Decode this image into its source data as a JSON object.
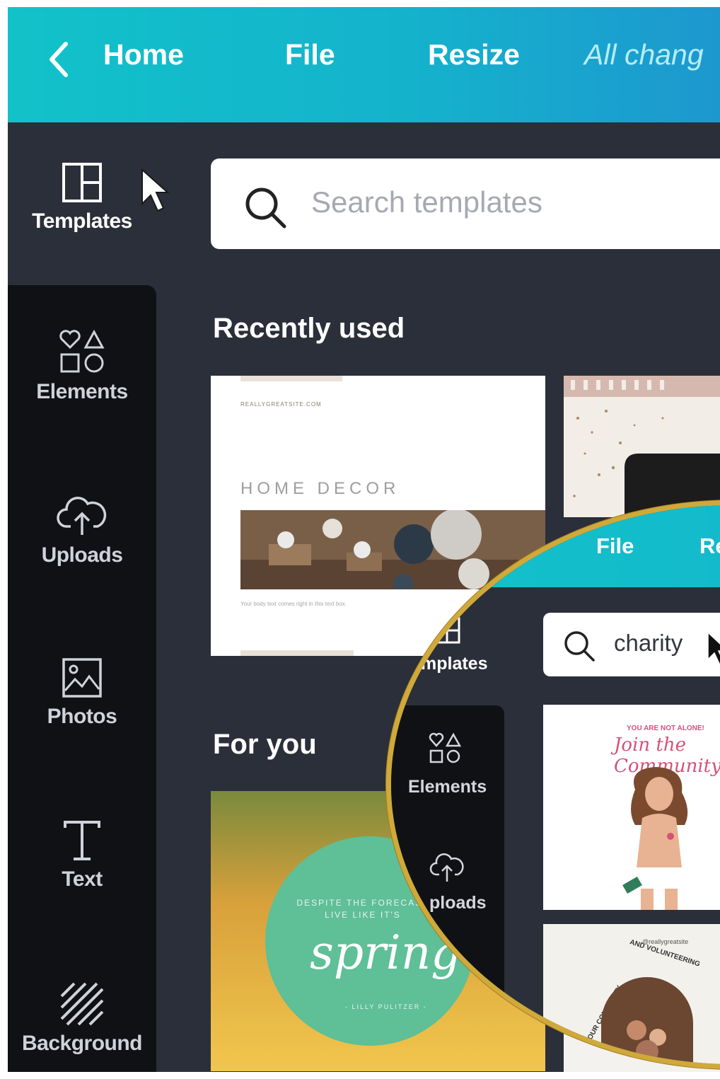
{
  "topbar": {
    "home": "Home",
    "file": "File",
    "resize": "Resize",
    "status": "All chang"
  },
  "sidebar": {
    "items": [
      {
        "label": "Templates",
        "icon": "templates-icon"
      },
      {
        "label": "Elements",
        "icon": "elements-icon"
      },
      {
        "label": "Uploads",
        "icon": "upload-cloud-icon"
      },
      {
        "label": "Photos",
        "icon": "photo-icon"
      },
      {
        "label": "Text",
        "icon": "text-icon"
      },
      {
        "label": "Background",
        "icon": "background-stripes-icon"
      }
    ]
  },
  "search": {
    "placeholder": "Search templates"
  },
  "sections": {
    "recent": "Recently used",
    "for_you": "For you"
  },
  "cards": {
    "home_decor": {
      "site": "REALLYGREATSITE.COM",
      "title": "HOME DECOR",
      "body": "Your body text comes right in this text box."
    },
    "spring": {
      "quote_line1": "DESPITE THE FORECAST",
      "quote_line2": "LIVE LIKE IT'S",
      "word": "spring",
      "author": "- LILLY PULITZER -"
    }
  },
  "magnifier": {
    "file": "File",
    "resize": "Re",
    "search_value": "charity",
    "templates": "mplates",
    "elements": "Elements",
    "uploads": "ploads",
    "card1_top": "YOU ARE NOT ALONE!",
    "card1_script": "Join the Community",
    "card2_handle": "@reallygreatsite",
    "card2_ring_a": "AND VOLUNTEERING",
    "card2_ring_b": "OUR COMMUNITY"
  },
  "colors": {
    "topbar_start": "#12c2c9",
    "topbar_end": "#1d98cf",
    "panel": "#2b2f3a",
    "sidebar_dark": "#0f1115",
    "lens_border": "#cfa93a",
    "spring_circle": "#5fbf96"
  }
}
